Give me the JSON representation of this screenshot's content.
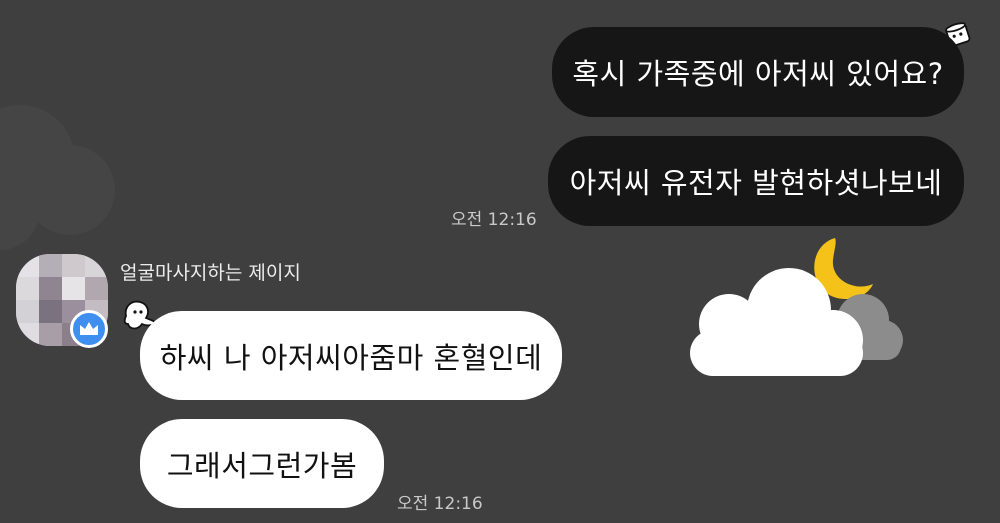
{
  "chat": {
    "outgoing": [
      {
        "text": "혹시 가족중에 아저씨 있어요?"
      },
      {
        "text": "아저씨 유전자 발현하셧나보네"
      }
    ],
    "outgoing_time": "오전 12:16",
    "sender": {
      "name": "얼굴마사지하는 제이지",
      "avatar_icon": "pixelated-avatar",
      "badge_icon": "crown-icon",
      "badge_color": "#3f8ff0"
    },
    "incoming": [
      {
        "text": "하씨 나 아저씨아줌마 혼혈인데"
      },
      {
        "text": "그래서그런가봄"
      }
    ],
    "incoming_time": "오전 12:16"
  },
  "theme": {
    "background": "#3f3f3f",
    "outgoing_bubble": "#161616",
    "incoming_bubble": "#ffffff",
    "moon_color": "#f5c21a"
  }
}
